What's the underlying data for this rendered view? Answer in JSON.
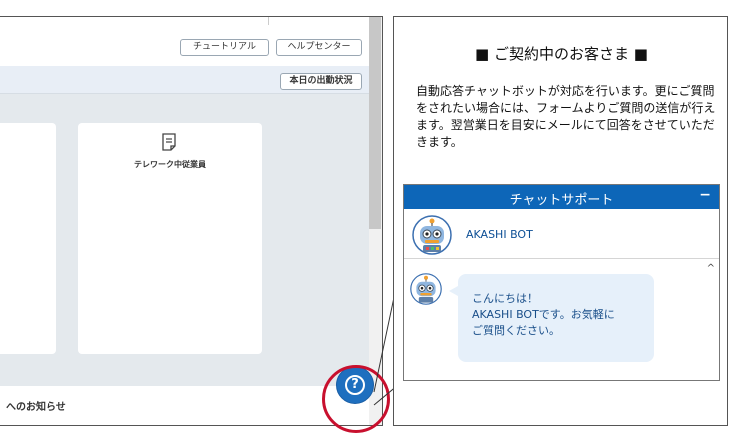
{
  "left_panel": {
    "tutorial_button": "チュートリアル",
    "help_center_button": "ヘルプセンター",
    "today_attendance_button": "本日の出勤状況",
    "card_telework_label": "テレワーク中従業員",
    "notice_text": "へのお知らせ",
    "help_button_icon": "help-question-icon",
    "help_button_glyph": "?"
  },
  "callout": {
    "title": "■ ご契約中のお客さま ■",
    "description": "自動応答チャットボットが対応を行います。更にご質問をされたい場合には、フォームよりご質問の送信が行えます。翌営業日を目安にメールにて回答をさせていただきます。"
  },
  "chat": {
    "header_title": "チャットサポート",
    "minimize_glyph": "−",
    "bot_name": "AKASHI BOT",
    "scroll_up_glyph": "^",
    "greeting": "こんにちは！",
    "message_line1": "AKASHI BOTです。お気軽に",
    "message_line2": "ご質問ください。"
  },
  "colors": {
    "chat_header": "#0d66b8",
    "help_button": "#1e6fbf",
    "highlight_circle": "#c8102e",
    "bubble": "#e6f0fa"
  }
}
